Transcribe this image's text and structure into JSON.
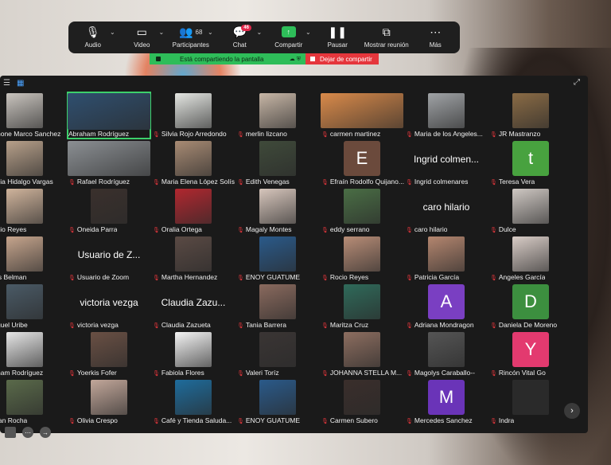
{
  "toolbar": {
    "items": [
      {
        "label": "Audio",
        "icon": "mic-icon",
        "chevron": true
      },
      {
        "label": "Video",
        "icon": "video-icon",
        "chevron": true
      },
      {
        "label": "Participantes",
        "icon": "participants-icon",
        "count": "68",
        "chevron": true
      },
      {
        "label": "Chat",
        "icon": "chat-icon",
        "badge": "46",
        "chevron": true
      },
      {
        "label": "Compartir",
        "icon": "share-icon",
        "chevron": true
      },
      {
        "label": "Pausar",
        "icon": "pause-icon"
      },
      {
        "label": "Mostrar reunión",
        "icon": "show-meeting-icon"
      },
      {
        "label": "Más",
        "icon": "more-icon"
      }
    ]
  },
  "sharebar": {
    "status": "Está compartiendo la pantalla",
    "stop": "Dejar de compartir"
  },
  "colors": {
    "accent_green": "#2ebd59",
    "stop_red": "#e5363c",
    "active_outline": "#3dd06b"
  },
  "participants": [
    [
      "hone Marco Sanchez",
      "Abraham Rodríguez",
      "Silvia Rojo Arredondo",
      "merlin lizcano",
      "carmen martinez",
      "Maria de los Angeles...",
      "JR Mastranzo"
    ],
    [
      "cia Hidalgo Vargas",
      "Rafael Rodríguez",
      "Maria Elena López Solís",
      "Edith Venegas",
      "Efraín Rodolfo Quijano...",
      "Ingrid colmenares",
      "Teresa Vera"
    ],
    [
      "cio Reyes",
      "Oneida Parra",
      "Oralia Ortega",
      "Magaly Montes",
      "eddy serrano",
      "caro hilario",
      "Dulce"
    ],
    [
      "is Belman",
      "Usuario de Zoom",
      "Martha Hernandez",
      "ENOY GUATUME",
      "Rocio Reyes",
      "Patricia García",
      "Angeles García"
    ],
    [
      "guel Uribe",
      "victoria vezga",
      "Claudia Zazueta",
      "Tania Barrera",
      "Maritza Cruz",
      "Adriana Mondragon",
      "Daniela De Moreno"
    ],
    [
      "ham Rodríguez",
      "Yoerkis Fofer",
      "Fabiola Flores",
      "Valeri Toríz",
      "JOHANNA STELLA M...",
      "Magolys Caraballo--",
      "Rincón Vital Go"
    ],
    [
      "ian Rocha",
      "Olivia Crespo",
      "Café y Tienda Saluda...",
      "ENOY GUATUME",
      "Carmen Subero",
      "Mercedes Sanchez",
      "Indra"
    ]
  ],
  "big_text": {
    "ingrid": "Ingrid colmen...",
    "caro": "caro hilario",
    "usuario": "Usuario de Z...",
    "victoria": "victoria vezga",
    "claudia": "Claudia Zazu..."
  },
  "letters": {
    "efrain": "E",
    "teresa": "t",
    "adriana": "A",
    "daniela": "D",
    "rincon": "Y",
    "mercedes": "M"
  }
}
